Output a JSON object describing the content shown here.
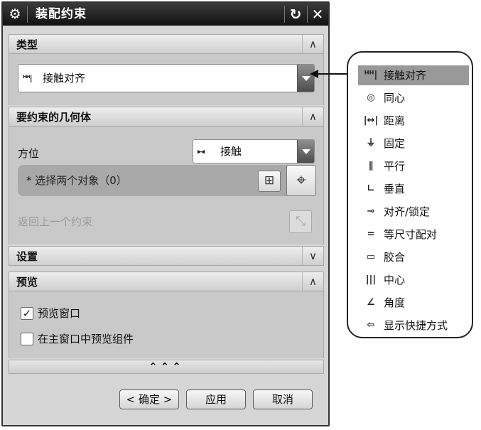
{
  "dialog": {
    "title": "装配约束"
  },
  "sections": {
    "type": {
      "label": "类型",
      "chevron": "∧"
    },
    "geometry": {
      "label": "要约束的几何体",
      "chevron": "∧"
    },
    "settings": {
      "label": "设置",
      "chevron": "∨"
    },
    "preview": {
      "label": "预览",
      "chevron": "∧"
    }
  },
  "type_combo": {
    "icon_glyph": "ᴴᴴ|",
    "value": "接触对齐"
  },
  "geometry": {
    "orientation_label": "方位",
    "orientation_value": "接触",
    "orientation_icon": "▸◂",
    "select_label": "* 选择两个对象（0）",
    "undo_label": "返回上一个约束"
  },
  "preview": {
    "preview_window_label": "预览窗口",
    "preview_window_checked": true,
    "main_window_label": "在主窗口中预览组件",
    "main_window_checked": false
  },
  "footer": {
    "expand_glyph": "⌃⌃⌃",
    "ok_label": "< 确定 >",
    "apply_label": "应用",
    "cancel_label": "取消"
  },
  "popup": {
    "items": [
      {
        "label": "接触对齐",
        "icon": "touch-align-icon",
        "glyph": "ᴴᴴ|",
        "selected": true
      },
      {
        "label": "同心",
        "icon": "concentric-icon",
        "glyph": "◎",
        "selected": false
      },
      {
        "label": "距离",
        "icon": "distance-icon",
        "glyph": "|↔|",
        "selected": false
      },
      {
        "label": "固定",
        "icon": "fix-icon",
        "glyph": "⏚",
        "selected": false
      },
      {
        "label": "平行",
        "icon": "parallel-icon",
        "glyph": "∥",
        "selected": false
      },
      {
        "label": "垂直",
        "icon": "perpendicular-icon",
        "glyph": "∟",
        "selected": false
      },
      {
        "label": "对齐/锁定",
        "icon": "align-lock-icon",
        "glyph": "⊸",
        "selected": false
      },
      {
        "label": "等尺寸配对",
        "icon": "equal-size-icon",
        "glyph": "=",
        "selected": false
      },
      {
        "label": "胶合",
        "icon": "glue-icon",
        "glyph": "▭",
        "selected": false
      },
      {
        "label": "中心",
        "icon": "center-icon",
        "glyph": "|||",
        "selected": false
      },
      {
        "label": "角度",
        "icon": "angle-icon",
        "glyph": "∠",
        "selected": false
      },
      {
        "label": "显示快捷方式",
        "icon": "shortcut-arrow-icon",
        "glyph": "⇦",
        "selected": false
      }
    ]
  },
  "colors": {
    "titlebar": "#111111",
    "panel": "#d6d6d6",
    "selected_item": "#999999"
  }
}
